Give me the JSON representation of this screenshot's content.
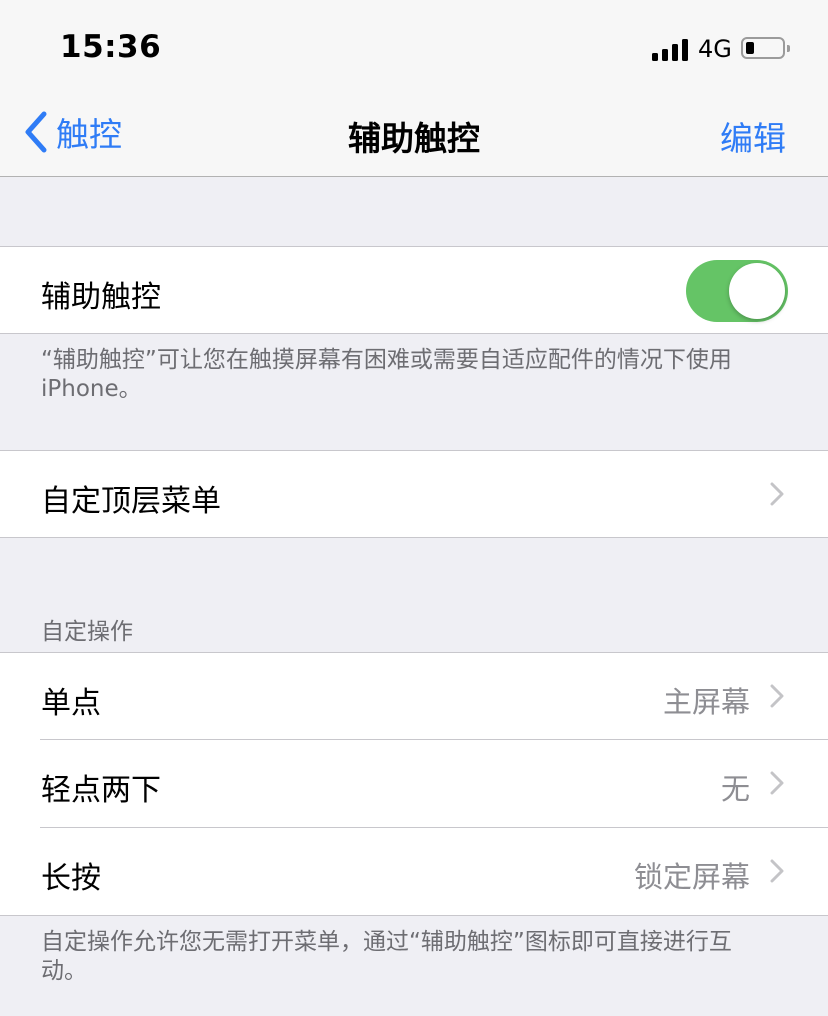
{
  "status": {
    "time": "15:36",
    "carrier": "4G"
  },
  "nav": {
    "back_label": "触控",
    "title": "辅助触控",
    "edit_label": "编辑"
  },
  "toggle_section": {
    "label": "辅助触控",
    "enabled": true,
    "footnote": "“辅助触控”可让您在触摸屏幕有困难或需要自适应配件的情况下使用 iPhone。"
  },
  "menu_section": {
    "label": "自定顶层菜单"
  },
  "custom_actions": {
    "header": "自定操作",
    "rows": [
      {
        "label": "单点",
        "value": "主屏幕"
      },
      {
        "label": "轻点两下",
        "value": "无"
      },
      {
        "label": "长按",
        "value": "锁定屏幕"
      }
    ],
    "footnote": "自定操作允许您无需打开菜单，通过“辅助触控”图标即可直接进行互动。"
  },
  "colors": {
    "accent": "#2f7cf6",
    "toggle_on": "#65c466",
    "background": "#efeff4"
  },
  "icons": {
    "back": "chevron-left-icon",
    "disclosure": "chevron-right-icon"
  }
}
